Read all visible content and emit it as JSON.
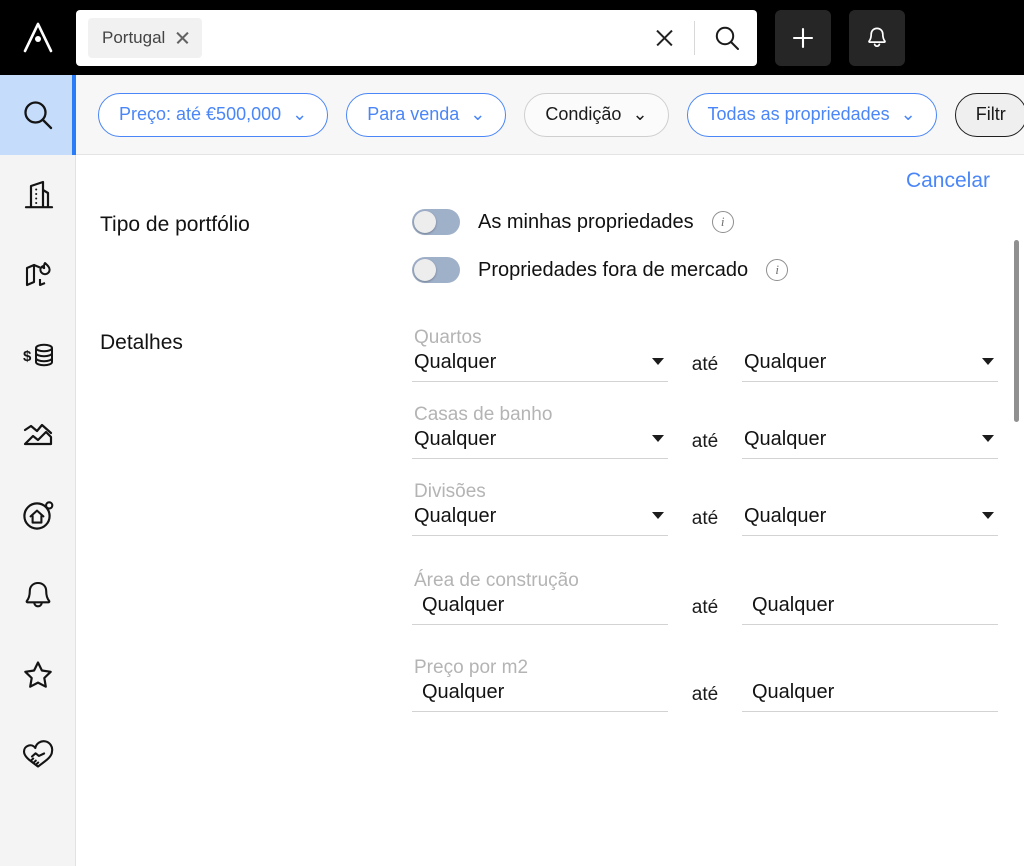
{
  "topbar": {
    "logo_name": "archer-logo",
    "search": {
      "chip_label": "Portugal",
      "chip_remove_icon": "close-icon",
      "placeholder": "",
      "value": "",
      "clear_icon": "close-icon",
      "submit_icon": "search-icon"
    },
    "add_button_icon": "plus-icon",
    "notifications_button_icon": "bell-icon"
  },
  "sidebar": {
    "items": [
      {
        "name": "search",
        "icon": "search-icon",
        "active": true
      },
      {
        "name": "buildings",
        "icon": "building-icon",
        "active": false
      },
      {
        "name": "heat-map",
        "icon": "map-flame-icon",
        "active": false
      },
      {
        "name": "comps",
        "icon": "dollar-coins-icon",
        "active": false
      },
      {
        "name": "analytics",
        "icon": "chart-area-icon",
        "active": false
      },
      {
        "name": "home-target",
        "icon": "home-circle-icon",
        "active": false
      },
      {
        "name": "alerts",
        "icon": "bell-icon",
        "active": false
      },
      {
        "name": "favorites",
        "icon": "star-icon",
        "active": false
      },
      {
        "name": "deals",
        "icon": "handshake-heart-icon",
        "active": false
      }
    ]
  },
  "filterbar": {
    "chips": [
      {
        "label": "Preço: até €500,000",
        "style": "blue",
        "caret": "⌄"
      },
      {
        "label": "Para venda",
        "style": "blue",
        "caret": "⌄"
      },
      {
        "label": "Condição",
        "style": "plain",
        "caret": "⌄"
      },
      {
        "label": "Todas as propriedades",
        "style": "blue",
        "caret": "⌄"
      },
      {
        "label": "Filtr",
        "style": "dark",
        "caret": ""
      }
    ]
  },
  "panel": {
    "cancel_label": "Cancelar",
    "portfolio": {
      "section_label": "Tipo de portfólio",
      "toggles": [
        {
          "label": "As minhas propriedades",
          "on": false,
          "info_icon": "info-icon"
        },
        {
          "label": "Propriedades fora de mercado",
          "on": false,
          "info_icon": "info-icon"
        }
      ]
    },
    "details": {
      "section_label": "Detalhes",
      "separator_label": "até",
      "fields": [
        {
          "title": "Quartos",
          "type": "select",
          "min_value": "Qualquer",
          "max_value": "Qualquer"
        },
        {
          "title": "Casas de banho",
          "type": "select",
          "min_value": "Qualquer",
          "max_value": "Qualquer"
        },
        {
          "title": "Divisões",
          "type": "select",
          "min_value": "Qualquer",
          "max_value": "Qualquer"
        },
        {
          "title": "Área de construção",
          "type": "text",
          "min_value": "Qualquer",
          "max_value": "Qualquer"
        },
        {
          "title": "Preço por m2",
          "type": "text",
          "min_value": "Qualquer",
          "max_value": "Qualquer"
        }
      ]
    }
  },
  "scrollbar": {
    "name": "vertical-scrollbar"
  },
  "colors": {
    "accent_blue": "#4a86f7",
    "active_nav_bg": "#c5dcfa",
    "topbar_bg": "#000000",
    "filterbar_bg": "#f7f7f7",
    "rail_bg": "#f4f4f4",
    "toggle_track": "#9fb0c9",
    "muted_label": "#b4b4b4"
  }
}
